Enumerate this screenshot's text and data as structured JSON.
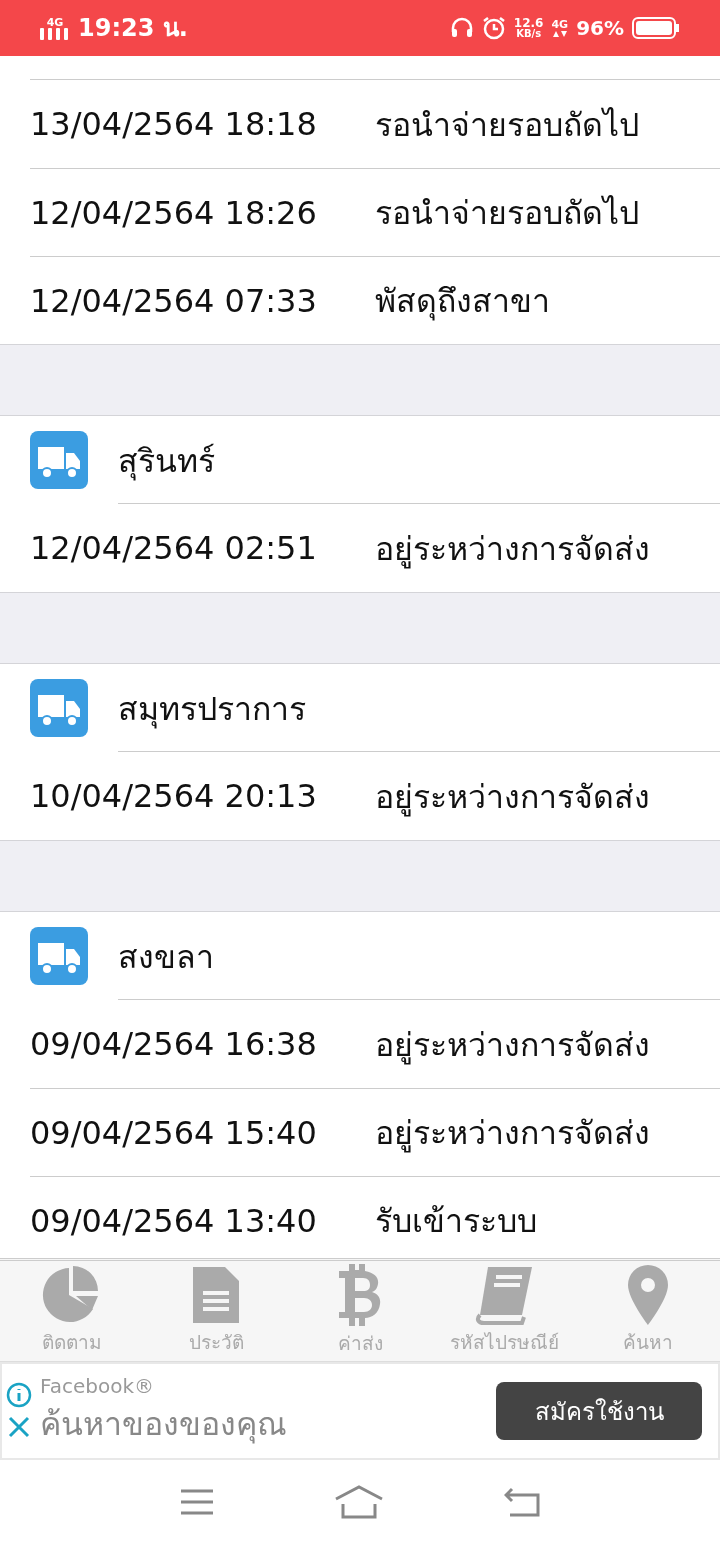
{
  "status_bar": {
    "network": "4G",
    "time": "19:23 น.",
    "speed": "12.6",
    "speed_unit": "KB/s",
    "network_type": "4G",
    "battery": "96%"
  },
  "groups": [
    {
      "events": [
        {
          "time": "13/04/2564 18:18",
          "status": "รอนำจ่ายรอบถัดไป"
        },
        {
          "time": "12/04/2564 18:26",
          "status": "รอนำจ่ายรอบถัดไป"
        },
        {
          "time": "12/04/2564 07:33",
          "status": "พัสดุถึงสาขา"
        }
      ]
    },
    {
      "location": "สุรินทร์",
      "events": [
        {
          "time": "12/04/2564 02:51",
          "status": "อยู่ระหว่างการจัดส่ง"
        }
      ]
    },
    {
      "location": "สมุทรปราการ",
      "events": [
        {
          "time": "10/04/2564 20:13",
          "status": "อยู่ระหว่างการจัดส่ง"
        }
      ]
    },
    {
      "location": "สงขลา",
      "events": [
        {
          "time": "09/04/2564 16:38",
          "status": "อยู่ระหว่างการจัดส่ง"
        },
        {
          "time": "09/04/2564 15:40",
          "status": "อยู่ระหว่างการจัดส่ง"
        },
        {
          "time": "09/04/2564 13:40",
          "status": "รับเข้าระบบ"
        }
      ]
    }
  ],
  "tabs": [
    {
      "label": "ติดตาม",
      "kind": "chart",
      "selected": false
    },
    {
      "label": "ประวัติ",
      "kind": "document",
      "selected": false
    },
    {
      "label": "ค่าส่ง",
      "kind": "bitcoin",
      "selected": false
    },
    {
      "label": "รหัสไปรษณีย์",
      "kind": "book",
      "selected": false
    },
    {
      "label": "ค้นหา",
      "kind": "pin",
      "selected": false
    }
  ],
  "ad": {
    "advertiser": "Facebook®",
    "headline": "ค้นหาของของคุณ",
    "button": "สมัครใช้งาน"
  }
}
